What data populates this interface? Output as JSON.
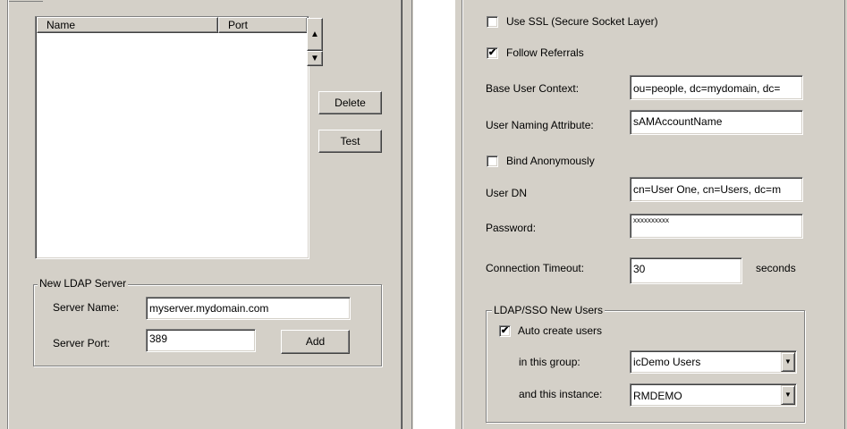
{
  "left": {
    "list_headers": {
      "name": "Name",
      "port": "Port"
    },
    "scroll_up_glyph": "▲",
    "scroll_down_glyph": "▼",
    "delete_label": "Delete",
    "test_label": "Test",
    "new_server_group": "New LDAP Server",
    "server_name_label": "Server Name:",
    "server_name_value": "myserver.mydomain.com",
    "server_port_label": "Server Port:",
    "server_port_value": "389",
    "add_label": "Add"
  },
  "right": {
    "use_ssl_label": "Use SSL (Secure Socket Layer)",
    "use_ssl_checked": "",
    "follow_referrals_label": "Follow Referrals",
    "follow_referrals_checked": "✔",
    "base_user_context_label": "Base User Context:",
    "base_user_context_value": "ou=people, dc=mydomain, dc=",
    "user_naming_attribute_label": "User Naming Attribute:",
    "user_naming_attribute_value": "sAMAccountName",
    "bind_anonymously_label": "Bind Anonymously",
    "bind_anonymously_checked": "",
    "user_dn_label": "User DN",
    "user_dn_value": "cn=User One, cn=Users, dc=m",
    "password_label": "Password:",
    "password_value": "xxxxxxxxxx",
    "connection_timeout_label": "Connection Timeout:",
    "connection_timeout_value": "30",
    "seconds_label": "seconds",
    "new_users_group": "LDAP/SSO New Users",
    "auto_create_label": "Auto create users",
    "auto_create_checked": "✔",
    "group_label": "in this group:",
    "group_value": "icDemo Users",
    "instance_label": "and this instance:",
    "instance_value": "RMDEMO",
    "dropdown_glyph": "▼"
  }
}
